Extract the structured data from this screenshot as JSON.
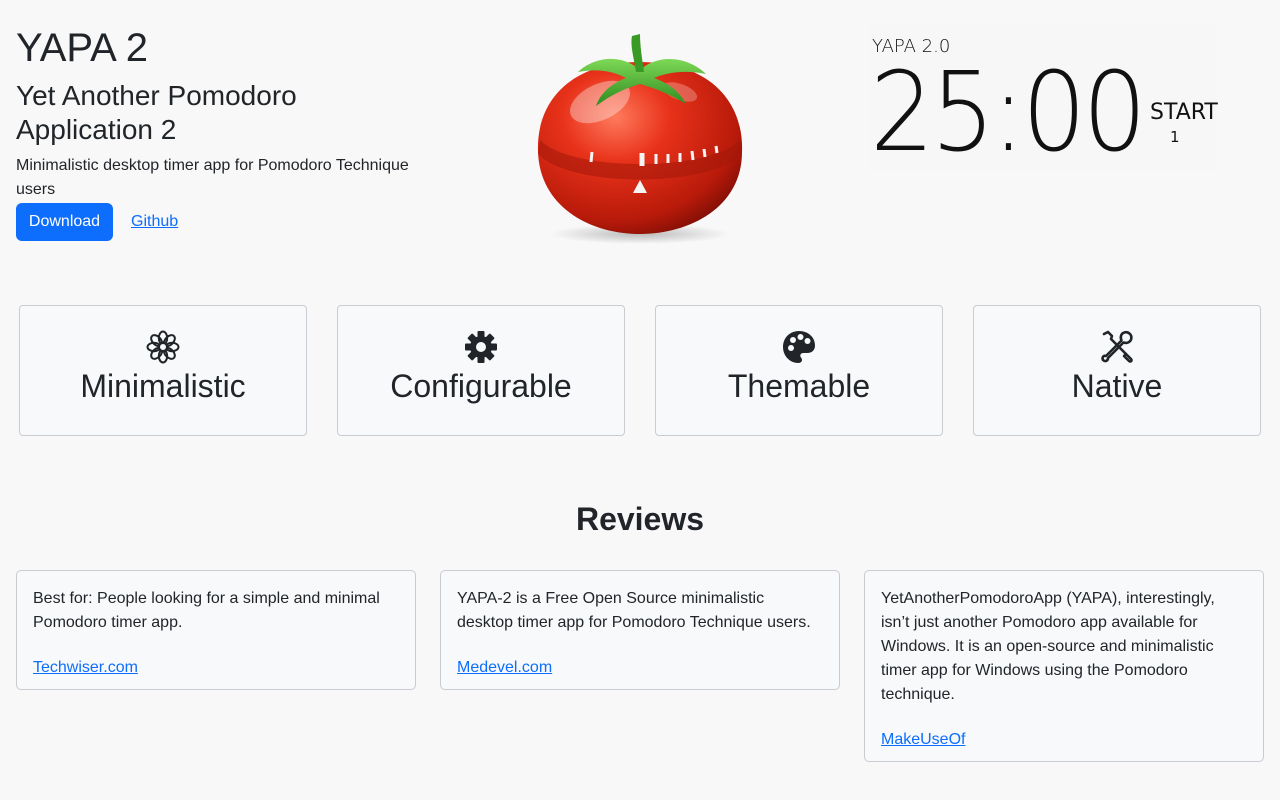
{
  "hero": {
    "title": "YAPA 2",
    "subtitle": "Yet Another Pomodoro Application 2",
    "description": "Minimalistic desktop timer app for Pomodoro Technique users",
    "download_label": "Download",
    "github_label": "Github"
  },
  "timer_preview": {
    "app_name": "YAPA 2.0",
    "time": "25:00",
    "start_label": "START",
    "count": "1"
  },
  "features": [
    {
      "label": "Minimalistic",
      "icon": "flower-icon"
    },
    {
      "label": "Configurable",
      "icon": "gear-icon"
    },
    {
      "label": "Themable",
      "icon": "palette-icon"
    },
    {
      "label": "Native",
      "icon": "tools-icon"
    }
  ],
  "reviews": {
    "title": "Reviews",
    "items": [
      {
        "text": "Best for: People looking for a simple and minimal Pomodoro timer app.",
        "source": "Techwiser.com"
      },
      {
        "text": "YAPA-2 is a Free Open Source minimalistic desktop timer app for Pomodoro Technique users.",
        "source": "Medevel.com"
      },
      {
        "text": "YetAnotherPomodoroApp (YAPA), interestingly, isn’t just another Pomodoro app available for Windows. It is an open-source and minimalistic timer app for Windows using the Pomodoro technique.",
        "source": "MakeUseOf"
      }
    ]
  },
  "colors": {
    "accent": "#0d6efd",
    "background": "#f8f8f8",
    "card": "#f8f9fa",
    "tomato": "#d42a12"
  }
}
